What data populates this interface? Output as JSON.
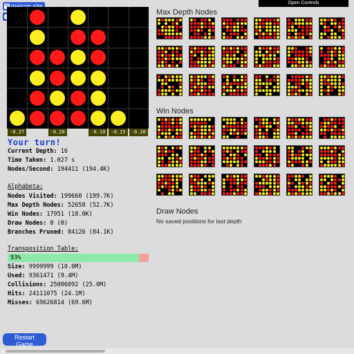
{
  "badges": {
    "site": "maicon.site",
    "help": "help"
  },
  "board": {
    "rows": [
      [
        ".",
        "r",
        ".",
        "y",
        ".",
        ".",
        "."
      ],
      [
        ".",
        "y",
        ".",
        "r",
        "r",
        ".",
        "."
      ],
      [
        ".",
        "r",
        "r",
        "y",
        "r",
        ".",
        "."
      ],
      [
        ".",
        "y",
        "r",
        "y",
        "y",
        ".",
        "."
      ],
      [
        ".",
        "r",
        "y",
        "r",
        "y",
        ".",
        "."
      ],
      [
        "y",
        "r",
        "r",
        "r",
        "y",
        "y",
        "."
      ]
    ],
    "scores": [
      "-0.27",
      "",
      "-0.20",
      "",
      "-0.10",
      "-0.15",
      "-0.20"
    ]
  },
  "status": {
    "turn": "Your turn!",
    "current_depth_label": "Current Depth:",
    "current_depth": "16",
    "time_label": "Time Taken:",
    "time": "1.027 s",
    "nps_label": "Nodes/Second:",
    "nps": "194411 (194.4K)"
  },
  "alphabeta": {
    "title": "Alphabeta:",
    "visited_label": "Nodes Visited:",
    "visited": "199660 (199.7K)",
    "maxdepth_label": "Max Depth Nodes:",
    "maxdepth": "52658 (52.7K)",
    "win_label": "Win Nodes:",
    "win": "17951 (18.0K)",
    "draw_label": "Draw Nodes:",
    "draw": "0 (0)",
    "pruned_label": "Branches Pruned:",
    "pruned": "84126 (84.1K)"
  },
  "transposition": {
    "title": "Transposition Table:",
    "fill_percent": 93,
    "fill_label": "93%",
    "size_label": "Size:",
    "size": "9999999 (10.0M)",
    "used_label": "Used:",
    "used": "9361471 (9.4M)",
    "collisions_label": "Collisions:",
    "collisions": "25006092 (25.0M)",
    "hits_label": "Hits:",
    "hits": "24111075 (24.1M)",
    "misses_label": "Misses:",
    "misses": "69626814 (69.6M)"
  },
  "restart_label": "Restart Game",
  "open_controls": "Open Controls",
  "sections": {
    "max_depth": "Max Depth Nodes",
    "win": "Win Nodes",
    "draw": "Draw Nodes",
    "draw_empty": "No saved positions for last depth"
  },
  "colors": {
    "red": "#ff1a1a",
    "yellow": "#ffee22",
    "accent": "#2f5bd6"
  }
}
